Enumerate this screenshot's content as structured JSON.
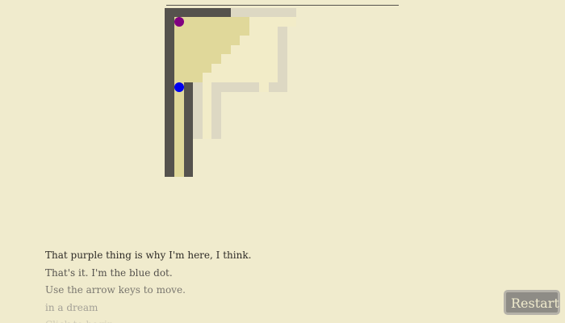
{
  "game": {
    "colors": {
      "background": "#f0ebcd",
      "wall": "#55524d",
      "fog_light": "#ddd8c3",
      "lit_floor": "#e0d89a",
      "dim_floor": "#f2ecc8",
      "player": "#0000ee",
      "target": "#800080"
    },
    "player_color_name": "blue",
    "target_color_name": "purple"
  },
  "log": [
    "That purple thing is why I'm here, I think.",
    "That's it. I'm the blue dot.",
    "Use the arrow keys to move.",
    "in a dream",
    "Click to begin"
  ],
  "restart_label": "Restart"
}
